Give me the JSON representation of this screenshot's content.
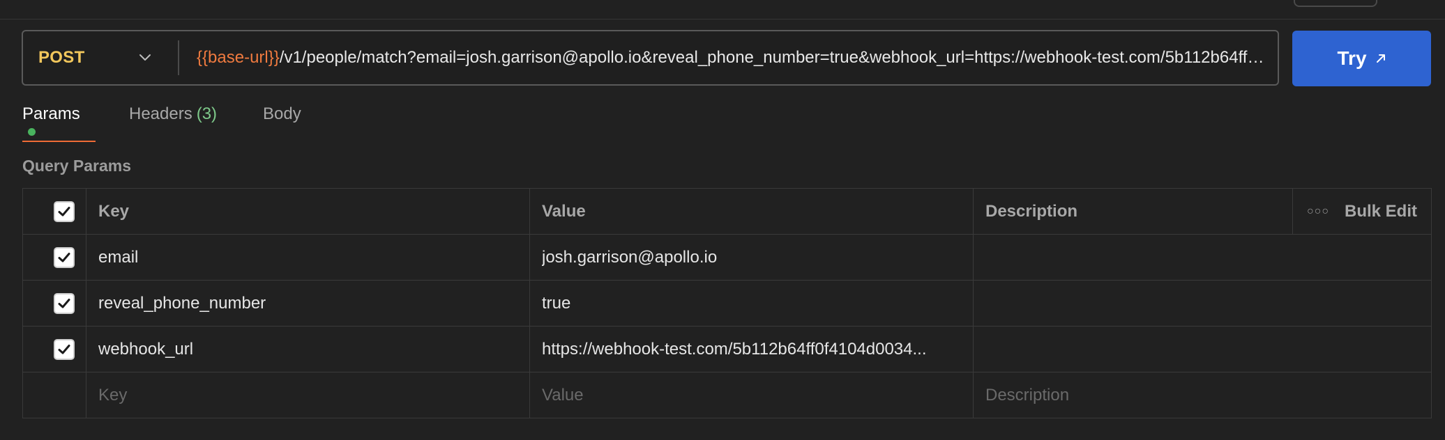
{
  "request": {
    "method": "POST",
    "url_variable": "{{base-url}}",
    "url_path": "/v1/people/match?email=josh.garrison@apollo.io&reveal_phone_number=true&webhook_url=https://webhook-test.com/5b112b64ff0f4104d0034"
  },
  "try_button": {
    "label": "Try"
  },
  "tabs": {
    "params": "Params",
    "headers": "Headers",
    "headers_count": "(3)",
    "body": "Body"
  },
  "section_title": "Query Params",
  "table": {
    "headers": {
      "key": "Key",
      "value": "Value",
      "description": "Description",
      "bulk_edit": "Bulk Edit"
    },
    "rows": [
      {
        "key": "email",
        "value": "josh.garrison@apollo.io",
        "description": "",
        "checked": true
      },
      {
        "key": "reveal_phone_number",
        "value": "true",
        "description": "",
        "checked": true
      },
      {
        "key": "webhook_url",
        "value": "https://webhook-test.com/5b112b64ff0f4104d0034...",
        "description": "",
        "checked": true
      }
    ],
    "placeholders": {
      "key": "Key",
      "value": "Value",
      "description": "Description"
    }
  },
  "colors": {
    "accent_try": "#2e63d1",
    "method": "#f2c75c",
    "variable": "#ef7a3f",
    "tab_indicator": "#ef6b36",
    "status_dot": "#49b35e"
  }
}
